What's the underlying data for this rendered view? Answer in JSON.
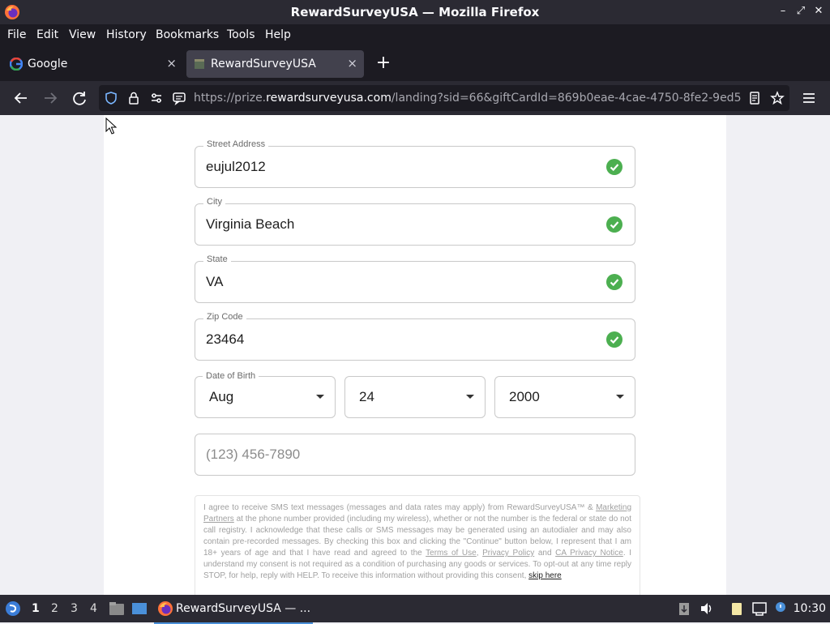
{
  "window": {
    "title": "RewardSurveyUSA — Mozilla Firefox"
  },
  "menu": [
    "File",
    "Edit",
    "View",
    "History",
    "Bookmarks",
    "Tools",
    "Help"
  ],
  "tabs": [
    {
      "label": "Google",
      "icon": "google-icon"
    },
    {
      "label": "RewardSurveyUSA",
      "icon": "site-icon"
    }
  ],
  "url": {
    "prefix": "https://prize.",
    "host": "rewardsurveyusa.com",
    "path": "/landing?sid=66&giftCardId=869b0eae-4cae-4750-8fe2-9ed5"
  },
  "form": {
    "street": {
      "label": "Street Address",
      "value": "eujul2012"
    },
    "city": {
      "label": "City",
      "value": "Virginia Beach"
    },
    "state": {
      "label": "State",
      "value": "VA"
    },
    "zip": {
      "label": "Zip Code",
      "value": "23464"
    },
    "dob": {
      "label": "Date of Birth",
      "month": "Aug",
      "day": "24",
      "year": "2000"
    },
    "phone": {
      "placeholder": "(123) 456-7890"
    }
  },
  "consent": {
    "t1": "I agree to receive SMS text messages (messages and data rates may apply) from RewardSurveyUSA™ & ",
    "link_marketing": "Marketing Partners",
    "t2": " at the phone number provided (including my wireless), whether or not the number is the federal or state do not call registry. I acknowledge that these calls or SMS messages may be generated using an autodialer and may also contain pre-recorded messages. By checking this box and clicking the \"Continue\" button below, I represent that I am 18+ years of age and that I have read and agreed to the ",
    "link_terms": "Terms of Use",
    "sep1": ", ",
    "link_privacy": "Privacy Policy",
    "sep2": " and ",
    "link_ca": "CA Privacy Notice",
    "t3": ". I understand my consent is not required as a condition of purchasing any goods or services. To opt-out at any time reply STOP, for help, reply with HELP. To receive this information without providing this consent, ",
    "link_skip": "skip here"
  },
  "taskbar": {
    "workspaces": [
      "1",
      "2",
      "3",
      "4"
    ],
    "app_label": "RewardSurveyUSA — ...",
    "clock": "10:30"
  },
  "colors": {
    "check": "#4caf50",
    "chrome_dark": "#2b2a33",
    "tab_active": "#42414d"
  }
}
